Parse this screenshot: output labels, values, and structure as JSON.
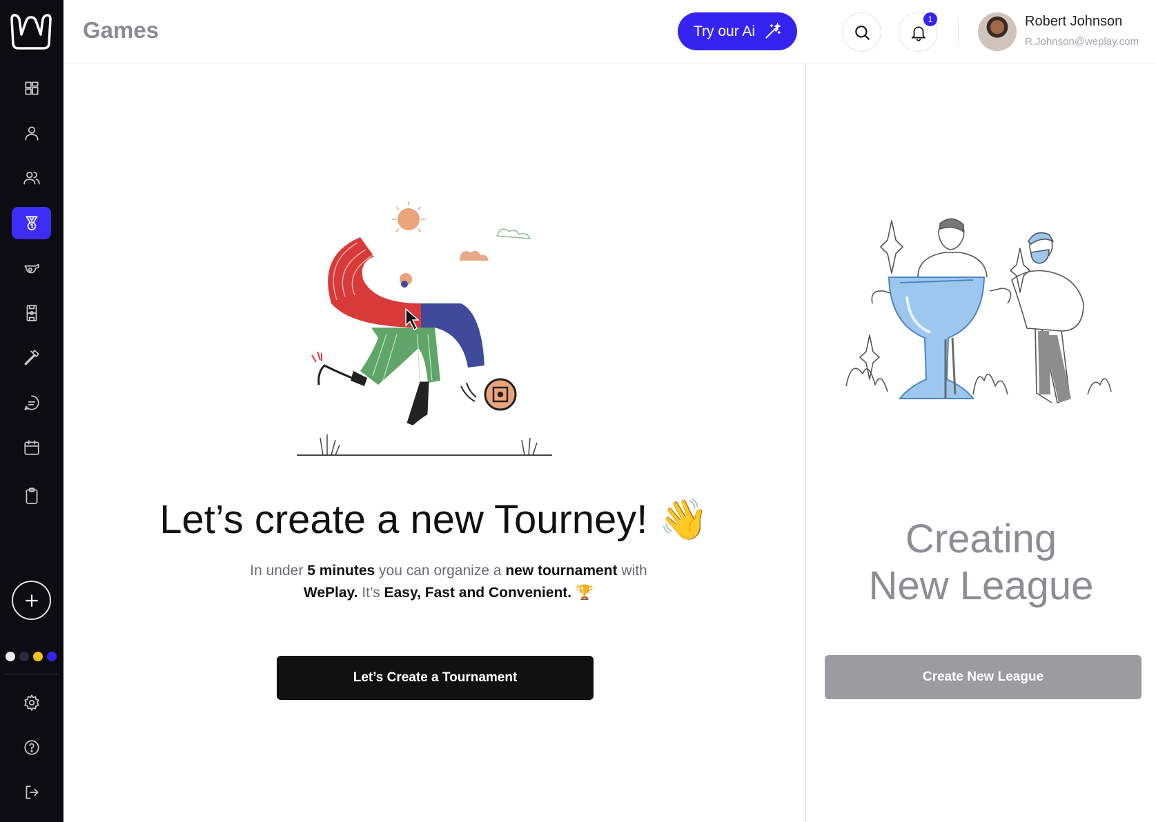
{
  "app": {
    "logo": "W"
  },
  "sidebar": {
    "items": [
      {
        "icon": "dashboard-icon"
      },
      {
        "icon": "user-icon"
      },
      {
        "icon": "users-icon"
      },
      {
        "icon": "medal-icon",
        "active": true
      },
      {
        "icon": "whistle-icon"
      },
      {
        "icon": "field-icon"
      },
      {
        "icon": "hammer-icon"
      },
      {
        "icon": "chat-icon"
      },
      {
        "icon": "calendar-icon"
      },
      {
        "icon": "clipboard-icon"
      }
    ],
    "add_icon": "plus-icon",
    "theme_colors": [
      "#e9e9ee",
      "#2a2a3c",
      "#f2c417",
      "#3524f0"
    ],
    "bottom": [
      {
        "icon": "settings-icon"
      },
      {
        "icon": "help-icon"
      },
      {
        "icon": "logout-icon"
      }
    ]
  },
  "header": {
    "title": "Games",
    "ai_button": "Try our Ai",
    "notification_count": "1",
    "user": {
      "name": "Robert Johnson",
      "email": "R.Johnson@weplay.com"
    }
  },
  "main": {
    "hero_title": "Let’s create a new Tourney! 👋",
    "subtitle": {
      "p1": "In under ",
      "b1": "5 minutes",
      "p2": " you can organize a ",
      "b2": "new tournament",
      "p3": " with ",
      "b3": "WePlay.",
      "p4": " It’s ",
      "b4": "Easy, Fast and Convenient.",
      "p5": " 🏆"
    },
    "primary_button": "Let’s Create a Tournament"
  },
  "league": {
    "title_line1": "Creating",
    "title_line2": "New League",
    "button": "Create New League"
  },
  "colors": {
    "accent": "#3524f0",
    "sidebar_bg": "#0c0c12"
  }
}
